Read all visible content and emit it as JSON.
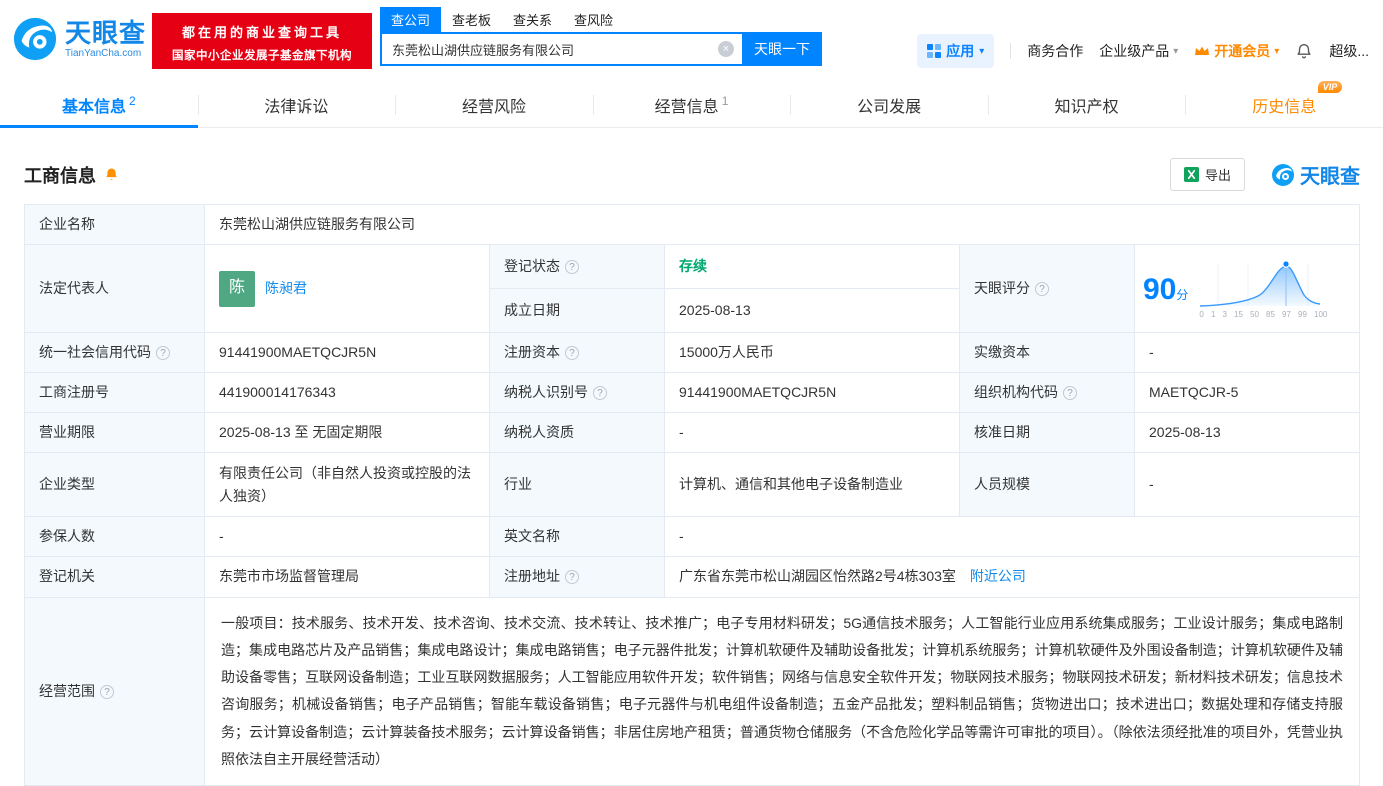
{
  "brand": {
    "name": "天眼查",
    "domain": "TianYanCha.com",
    "slogan_line1": "都在用的商业查询工具",
    "slogan_line2": "国家中小企业发展子基金旗下机构",
    "colors": {
      "primary": "#0084ff",
      "red": "#e60014",
      "orange": "#ff8a00",
      "green": "#00a870",
      "link": "#128bed",
      "label_bg": "#f3f9fd"
    }
  },
  "search": {
    "tabs": [
      {
        "label": "查公司"
      },
      {
        "label": "查老板"
      },
      {
        "label": "查关系"
      },
      {
        "label": "查风险"
      }
    ],
    "value": "东莞松山湖供应链服务有限公司",
    "button": "天眼一下"
  },
  "topnav": {
    "apps": "应用",
    "cooperation": "商务合作",
    "enterprise": "企业级产品",
    "vip": "开通会员",
    "super": "超级..."
  },
  "tabs": [
    {
      "label": "基本信息",
      "badge": "2"
    },
    {
      "label": "法律诉讼"
    },
    {
      "label": "经营风险"
    },
    {
      "label": "经营信息",
      "badge": "1"
    },
    {
      "label": "公司发展"
    },
    {
      "label": "知识产权"
    },
    {
      "label": "历史信息",
      "vip_tag": "VIP"
    }
  ],
  "section": {
    "title": "工商信息",
    "export": "导出",
    "logo": "天眼查"
  },
  "table": {
    "company_name_label": "企业名称",
    "company_name": "东莞松山湖供应链服务有限公司",
    "legal_rep_label": "法定代表人",
    "avatar_char": "陈",
    "legal_rep_name": "陈昶君",
    "reg_status_label": "登记状态",
    "reg_status": "存续",
    "establish_label": "成立日期",
    "establish_date": "2025-08-13",
    "score_label": "天眼评分",
    "score_value": "90",
    "score_unit": "分",
    "credit_code_label": "统一社会信用代码",
    "credit_code": "91441900MAETQCJR5N",
    "reg_capital_label": "注册资本",
    "reg_capital": "15000万人民币",
    "paid_capital_label": "实缴资本",
    "paid_capital": "-",
    "reg_number_label": "工商注册号",
    "reg_number": "441900014176343",
    "taxpayer_id_label": "纳税人识别号",
    "taxpayer_id": "91441900MAETQCJR5N",
    "org_code_label": "组织机构代码",
    "org_code": "MAETQCJR-5",
    "business_term_label": "营业期限",
    "business_term": "2025-08-13 至 无固定期限",
    "taxpayer_quality_label": "纳税人资质",
    "taxpayer_quality": "-",
    "approval_date_label": "核准日期",
    "approval_date": "2025-08-13",
    "company_type_label": "企业类型",
    "company_type": "有限责任公司（非自然人投资或控股的法人独资）",
    "industry_label": "行业",
    "industry": "计算机、通信和其他电子设备制造业",
    "staff_size_label": "人员规模",
    "staff_size": "-",
    "insured_label": "参保人数",
    "insured": "-",
    "english_name_label": "英文名称",
    "english_name": "-",
    "reg_authority_label": "登记机关",
    "reg_authority": "东莞市市场监督管理局",
    "address_label": "注册地址",
    "address": "广东省东莞市松山湖园区怡然路2号4栋303室",
    "nearby_link": "附近公司",
    "business_scope_label": "经营范围",
    "business_scope": "一般项目：技术服务、技术开发、技术咨询、技术交流、技术转让、技术推广；电子专用材料研发；5G通信技术服务；人工智能行业应用系统集成服务；工业设计服务；集成电路制造；集成电路芯片及产品销售；集成电路设计；集成电路销售；电子元器件批发；计算机软硬件及辅助设备批发；计算机系统服务；计算机软硬件及外围设备制造；计算机软硬件及辅助设备零售；互联网设备制造；工业互联网数据服务；人工智能应用软件开发；软件销售；网络与信息安全软件开发；物联网技术服务；物联网技术研发；新材料技术研发；信息技术咨询服务；机械设备销售；电子产品销售；智能车载设备销售；电子元器件与机电组件设备制造；五金产品批发；塑料制品销售；货物进出口；技术进出口；数据处理和存储支持服务；云计算设备制造；云计算装备技术服务；云计算设备销售；非居住房地产租赁；普通货物仓储服务（不含危险化学品等需许可审批的项目）。（除依法须经批准的项目外，凭营业执照依法自主开展经营活动）",
    "score_chart": {
      "type": "area",
      "score": 90,
      "ticks": [
        "0",
        "1",
        "3",
        "15",
        "50",
        "85",
        "97",
        "99",
        "100"
      ]
    }
  }
}
